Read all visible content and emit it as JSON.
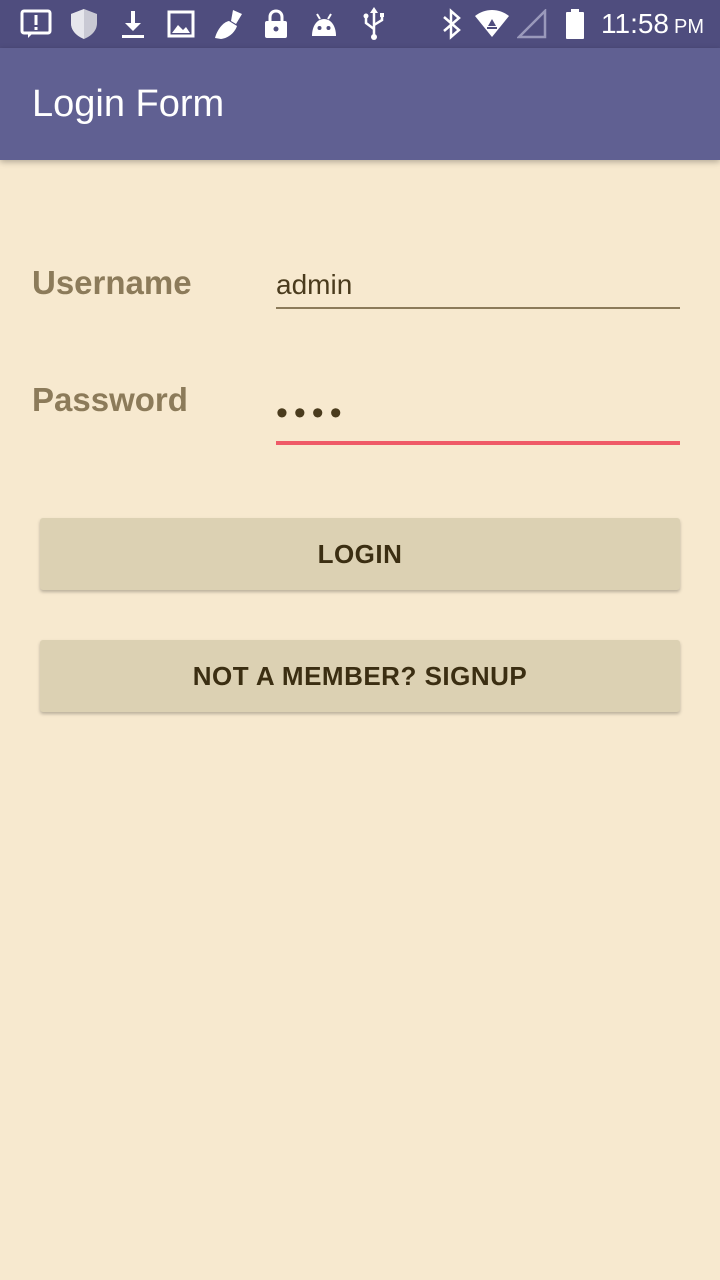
{
  "status_bar": {
    "time": "11:58",
    "ampm": "PM",
    "left_icons": [
      "alert-icon",
      "shield-icon",
      "download-icon",
      "image-icon",
      "broom-icon",
      "lock-icon",
      "android-icon",
      "usb-icon"
    ],
    "right_icons": [
      "bluetooth-icon",
      "wifi-icon",
      "signal-icon",
      "battery-icon"
    ]
  },
  "app_bar": {
    "title": "Login Form"
  },
  "form": {
    "username_label": "Username",
    "username_value": "admin",
    "password_label": "Password",
    "password_value": "••••"
  },
  "buttons": {
    "login": "LOGIN",
    "signup": "NOT A MEMBER? SIGNUP"
  },
  "colors": {
    "status_bar": "#4f4d7e",
    "app_bar": "#606092",
    "background": "#f7e9cf",
    "focus_underline": "#ef5a67",
    "button": "#dcd1b3"
  }
}
